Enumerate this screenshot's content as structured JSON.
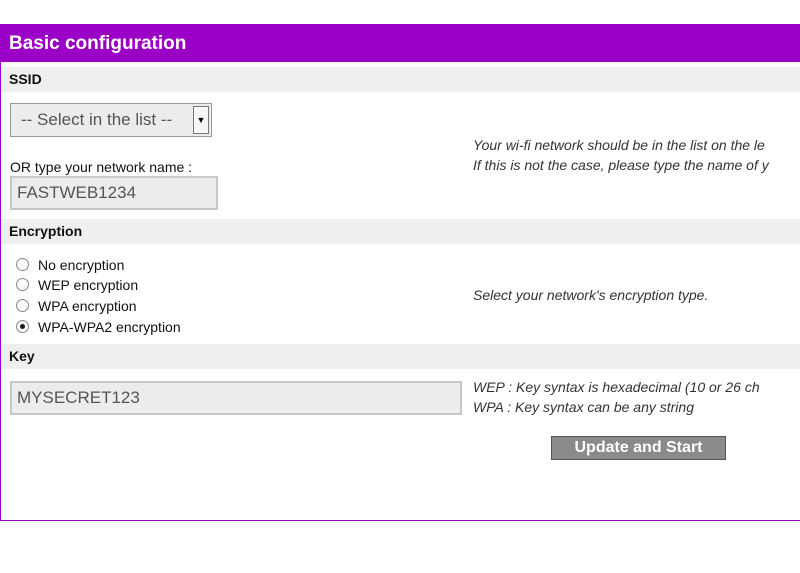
{
  "form": {
    "title": "Basic configuration",
    "ssid": {
      "heading": "SSID",
      "select_selected": "-- Select in the list --",
      "or_label": "OR type your network name :",
      "network_name_value": "FASTWEB1234",
      "help_line1": "Your wi-fi network should be in the list on the le",
      "help_line2": "If this is not the case, please type the name of y"
    },
    "encryption": {
      "heading": "Encryption",
      "options": [
        {
          "label": "No encryption",
          "selected": false
        },
        {
          "label": "WEP encryption",
          "selected": false
        },
        {
          "label": "WPA encryption",
          "selected": false
        },
        {
          "label": "WPA-WPA2 encryption",
          "selected": true
        }
      ],
      "help": "Select your network's encryption type."
    },
    "key": {
      "heading": "Key",
      "value": "MYSECRET123",
      "help_line1": "WEP : Key syntax is hexadecimal (10 or 26 ch",
      "help_line2": "WPA : Key syntax can be any string"
    },
    "submit_label": "Update and Start"
  },
  "colors": {
    "accent": "#9b00c6",
    "section_bg": "#efefef",
    "button_bg": "#8a8a8a"
  }
}
